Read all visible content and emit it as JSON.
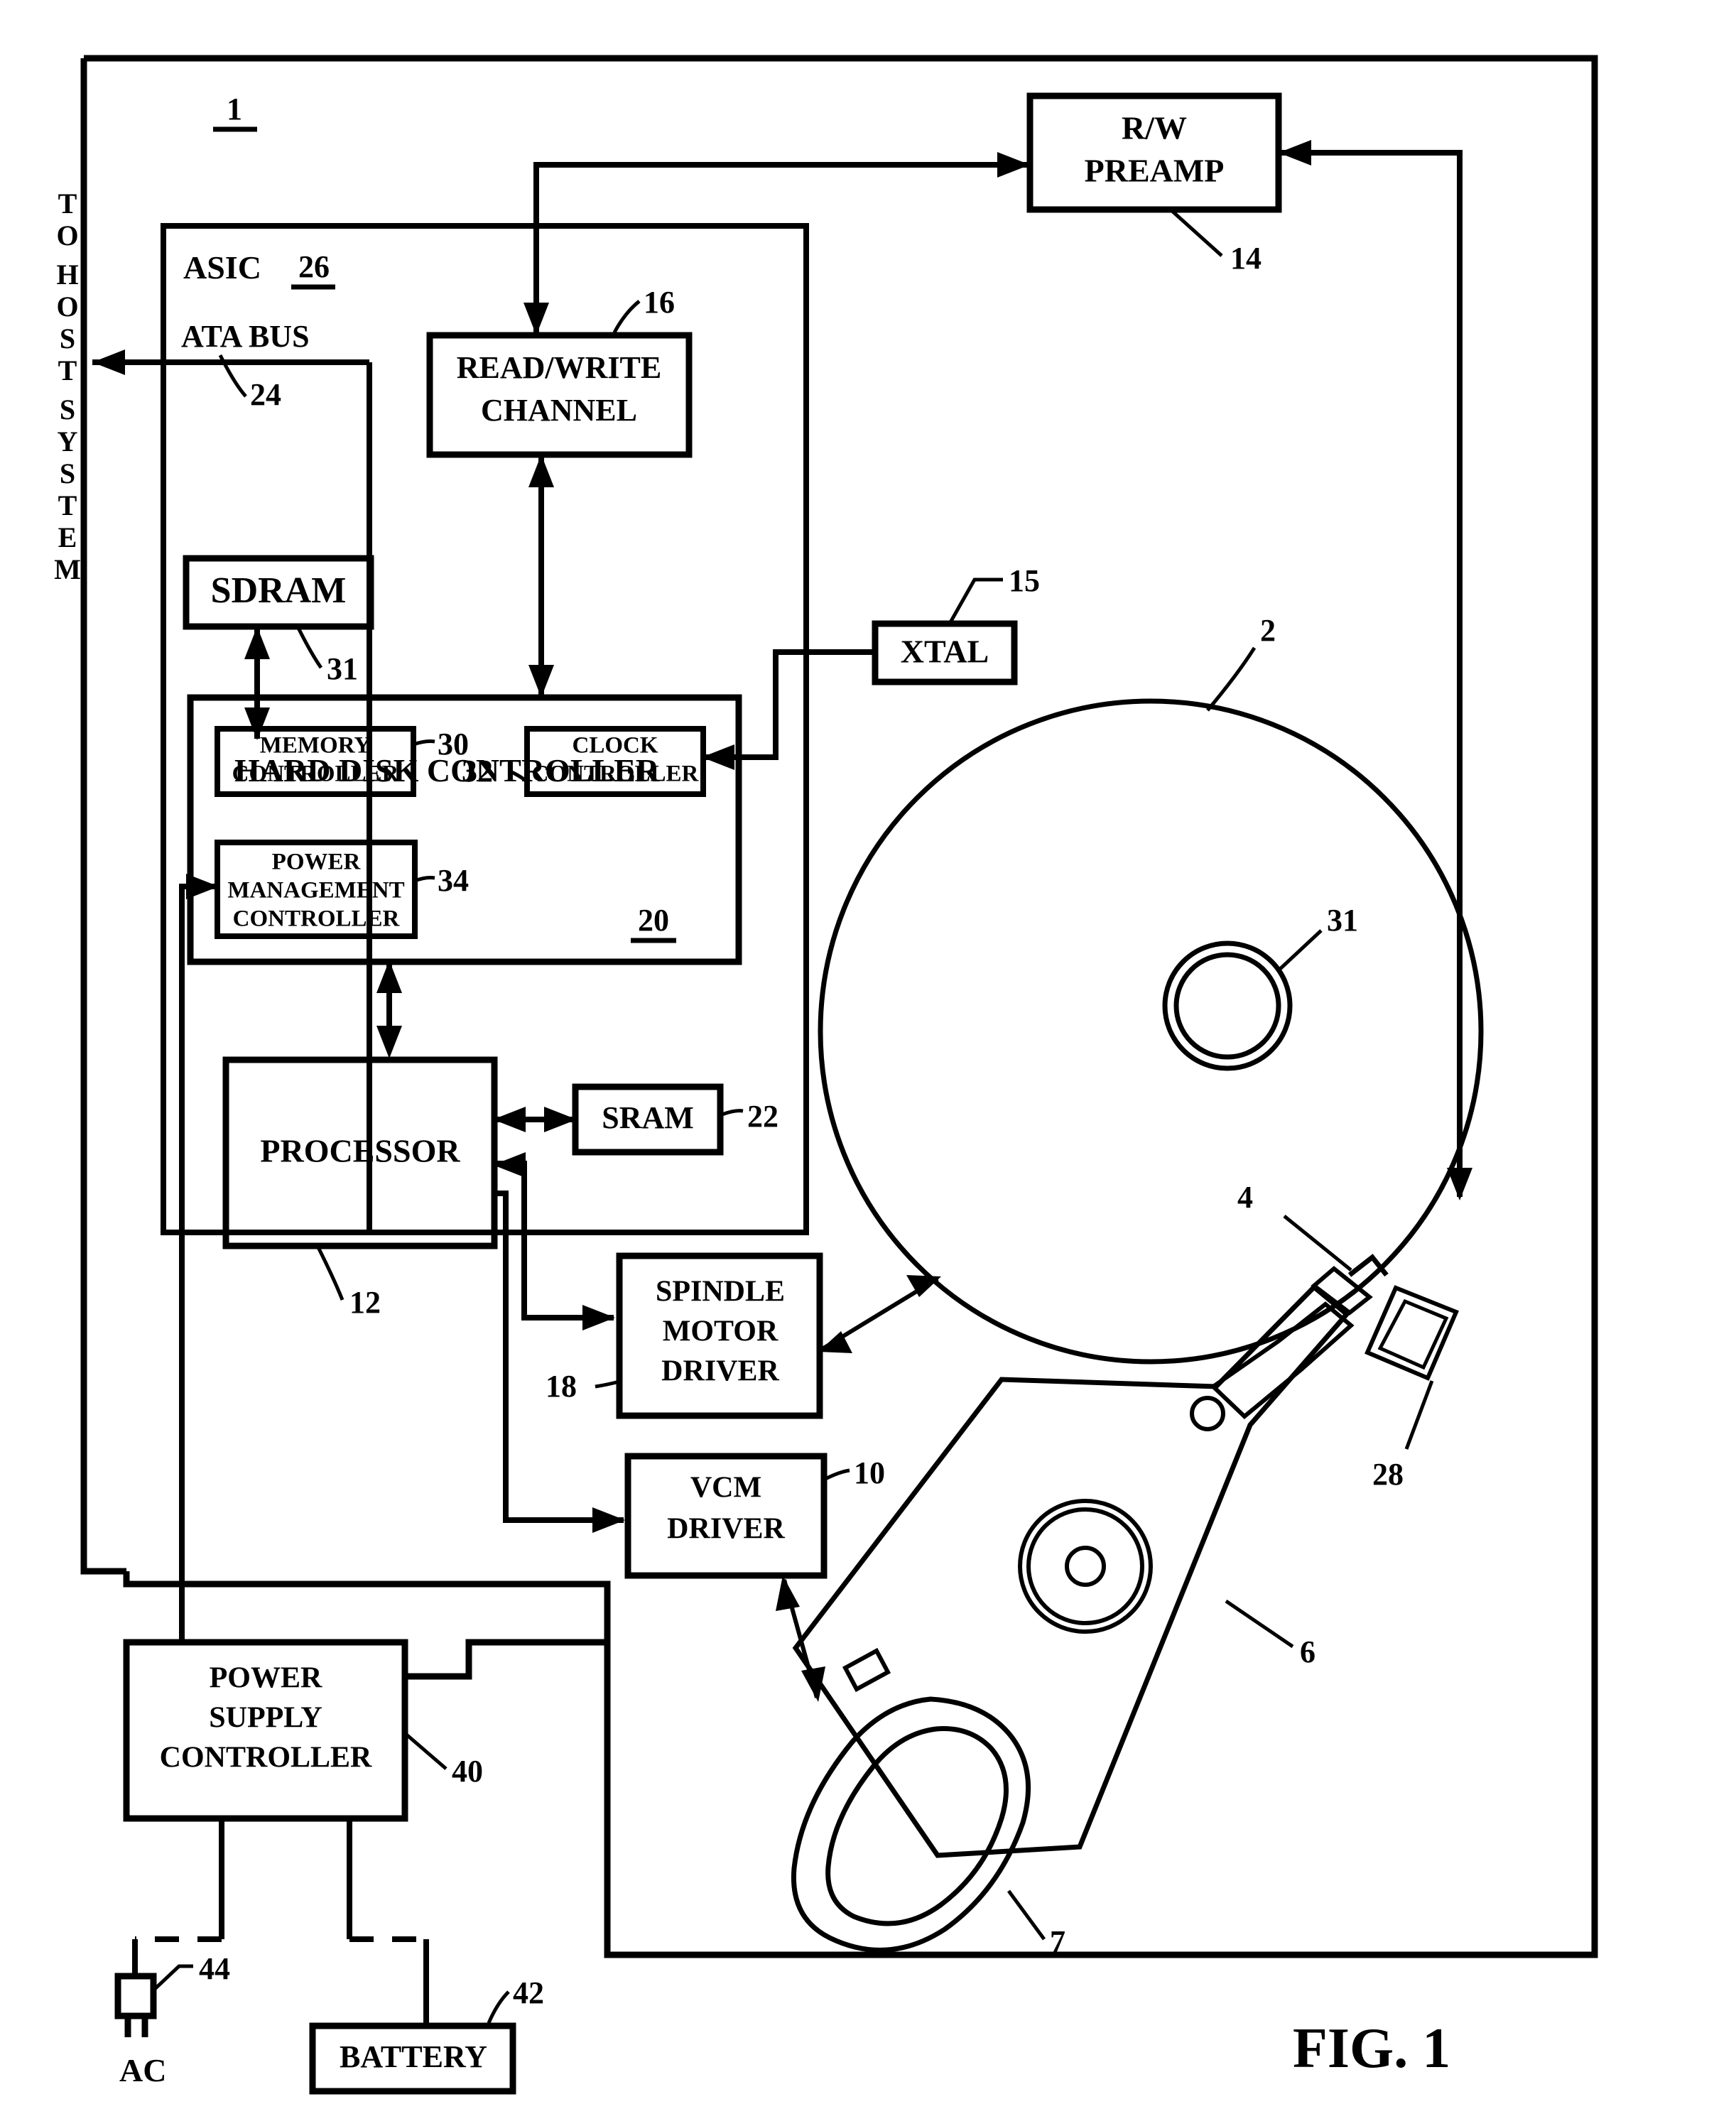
{
  "figure": {
    "caption": "FIG. 1",
    "assembly_ref": "1"
  },
  "host": {
    "label_letters": [
      "T",
      "O",
      "H",
      "O",
      "S",
      "T",
      "S",
      "Y",
      "S",
      "T",
      "E",
      "M"
    ],
    "label_text": "TO HOST SYSTEM"
  },
  "asic": {
    "title": "ASIC",
    "ref": "26",
    "bus_label": "ATA BUS",
    "bus_ref": "24"
  },
  "blocks": {
    "rw_preamp": {
      "lines": [
        "R/W",
        "PREAMP"
      ],
      "ref": "14"
    },
    "read_write_channel": {
      "lines": [
        "READ/WRITE",
        "CHANNEL"
      ],
      "ref": "16"
    },
    "sdram": {
      "lines": [
        "SDRAM"
      ],
      "ref": "31"
    },
    "xtal": {
      "lines": [
        "XTAL"
      ],
      "ref": "15"
    },
    "memory_controller": {
      "lines": [
        "MEMORY",
        "CONTROLLER"
      ],
      "ref": "30"
    },
    "clock_controller": {
      "lines": [
        "CLOCK",
        "CONTROLLER"
      ],
      "ref": "32"
    },
    "hard_disk_controller": {
      "title": "HARD DISK CONTROLLER",
      "ref": "20"
    },
    "power_management_controller": {
      "lines": [
        "POWER",
        "MANAGEMENT",
        "CONTROLLER"
      ],
      "ref": "34"
    },
    "processor": {
      "lines": [
        "PROCESSOR"
      ],
      "ref": "12"
    },
    "sram": {
      "lines": [
        "SRAM"
      ],
      "ref": "22"
    },
    "spindle_motor_driver": {
      "lines": [
        "SPINDLE",
        "MOTOR",
        "DRIVER"
      ],
      "ref": "18"
    },
    "vcm_driver": {
      "lines": [
        "VCM",
        "DRIVER"
      ],
      "ref": "10"
    },
    "power_supply_controller": {
      "lines": [
        "POWER",
        "SUPPLY",
        "CONTROLLER"
      ],
      "ref": "40"
    },
    "battery": {
      "lines": [
        "BATTERY"
      ],
      "ref": "42"
    },
    "ac_plug": {
      "label": "AC",
      "ref": "44"
    }
  },
  "mechanics": {
    "disk_ref": "2",
    "spindle_hub_ref": "31",
    "head_ref": "4",
    "actuator_arm_ref": "6",
    "voice_coil_ref": "7",
    "ramp_ref": "28"
  }
}
